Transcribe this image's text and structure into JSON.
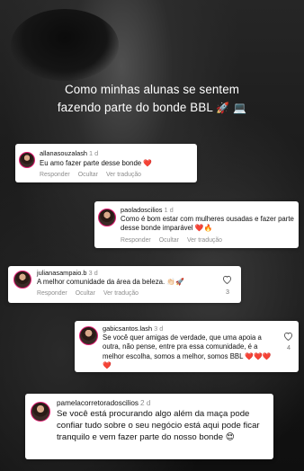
{
  "headline": {
    "line1": "Como minhas alunas se sentem",
    "line2": "fazendo parte do bonde BBL",
    "emoji1": "🚀",
    "emoji2": "💻"
  },
  "comments": [
    {
      "username": "allanasouzalash",
      "time": "1 d",
      "text": "Eu amo fazer parte desse bonde ❤️",
      "reply": "Responder",
      "hide": "Ocultar",
      "translate": "Ver tradução"
    },
    {
      "username": "paoladoscilios",
      "time": "1 d",
      "text": "Como é bom estar com mulheres ousadas e fazer parte desse bonde imparável ❤️🔥",
      "reply": "Responder",
      "hide": "Ocultar",
      "translate": "Ver tradução"
    },
    {
      "username": "julianasampaio.b",
      "time": "3 d",
      "text": "A melhor comunidade da área da beleza. 👏🏻🚀",
      "reply": "Responder",
      "hide": "Ocultar",
      "translate": "Ver tradução",
      "likes": "3"
    },
    {
      "username": "gabicsantos.lash",
      "time": "3 d",
      "text": "Se você quer amigas de verdade, que uma apoia a outra, não pense, entre pra essa comunidade, é a melhor escolha, somos a melhor, somos BBL ❤️❤️❤️❤️",
      "likes": "4"
    },
    {
      "username": "pamelacorretoradoscilios",
      "time": "2 d",
      "text": "Se você está procurando algo além da maça pode confiar tudo sobre o seu negócio está aqui pode ficar tranquilo e vem fazer parte do nosso bonde 😍"
    }
  ],
  "colors": {
    "accent_ring": "#e21e74",
    "heart_red": "#e0243c",
    "meta_gray": "#8e8e8e"
  }
}
